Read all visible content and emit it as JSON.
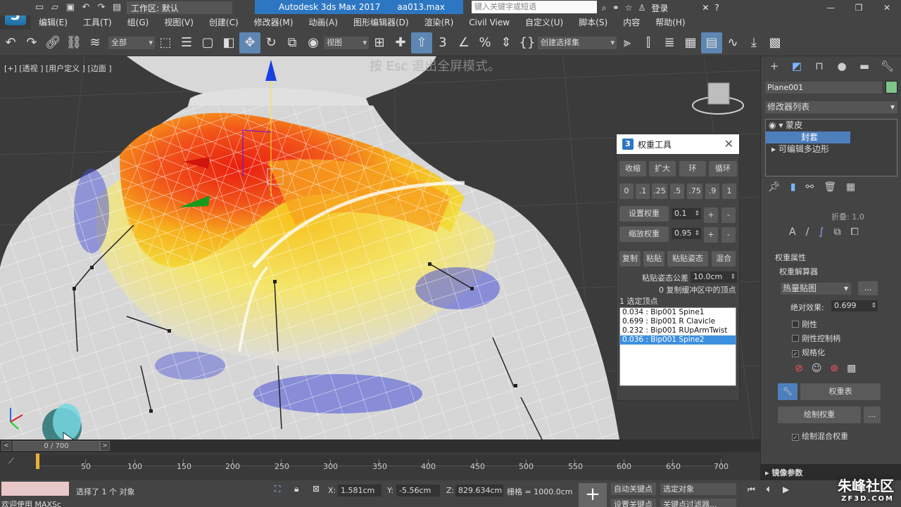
{
  "app": {
    "logo_text": "3",
    "workspace": "工作区: 默认",
    "window_title": "Autodesk 3ds Max 2017",
    "file_name": "aa013.max",
    "search_placeholder": "键入关键字或短语",
    "login_label": "登录"
  },
  "menu": [
    "编辑(E)",
    "工具(T)",
    "组(G)",
    "视图(V)",
    "创建(C)",
    "修改器(M)",
    "动画(A)",
    "图形编辑器(D)",
    "渲染(R)",
    "Civil View",
    "自定义(U)",
    "脚本(S)",
    "内容",
    "帮助(H)"
  ],
  "toolbar": {
    "select_filter": "全部",
    "ref_coord": "视图",
    "named_selection": "创建选择集"
  },
  "viewport": {
    "label": "[+] [透视 ] [用户定义 ] [边面 ]",
    "hint": "按 Esc 退出全屏模式。"
  },
  "weight_tool": {
    "title": "权重工具",
    "shrink": "收缩",
    "grow": "扩大",
    "ring": "环",
    "loop": "循环",
    "presets": [
      "0",
      ".1",
      ".25",
      ".5",
      ".75",
      ".9",
      "1"
    ],
    "set_weight": "设置权重",
    "set_weight_value": "0.1",
    "scale_weight": "缩放权重",
    "scale_weight_value": "0.95",
    "plus": "+",
    "minus": "-",
    "copy": "复制",
    "paste": "粘贴",
    "paste_pos": "粘贴姿态",
    "blend": "混合",
    "paste_tolerance_label": "粘贴姿态公差",
    "paste_tolerance_value": "10.0cm",
    "buffer_text": "0 复制缓冲区中的顶点",
    "selected_text": "1 选定顶点",
    "influences": [
      "0.034 : Bip001 Spine1",
      "0.699 : Bip001 R Clavicle",
      "0.232 : Bip001 RUpArmTwist",
      "0.036 : Bip001 Spine2"
    ],
    "selected_index": 3
  },
  "command_panel": {
    "object_name": "Plane001",
    "object_color": "#7fc58a",
    "modifier_list": "修改器列表",
    "stack": {
      "skin": "蒙皮",
      "envelope": "封套",
      "editable_poly": "可编辑多边形"
    },
    "falloff_label": "折叠: 1.0",
    "weight_props": "权重属性",
    "weight_solver": "权重解算器",
    "heat_map": "热量贴图",
    "more": "...",
    "abs_effect_label": "绝对效果:",
    "abs_effect_value": "0.699",
    "rigid": "刚性",
    "rigid_handles": "刚性控制柄",
    "normalize": "规格化",
    "weight_table": "权重表",
    "paint_weights": "绘制权重",
    "paint_blend": "绘制混合权重",
    "mirror_params": "镜像参数"
  },
  "timeline": {
    "frame": "0 / 700",
    "ticks": [
      "50",
      "100",
      "150",
      "200",
      "250",
      "300",
      "350",
      "400",
      "450",
      "500",
      "550",
      "600",
      "650",
      "700"
    ]
  },
  "status": {
    "selected": "选择了 1 个 对象",
    "welcome": "欢迎使用 MAXSc",
    "x_label": "X:",
    "x_value": "1.581cm",
    "y_label": "Y:",
    "y_value": "-5.56cm",
    "z_label": "Z:",
    "z_value": "829.634cm",
    "grid": "栅格 = 1000.0cm",
    "auto_key": "自动关键点",
    "selected_obj": "选定对象",
    "set_key": "设置关键点",
    "key_filter": "关键点过滤器..."
  },
  "watermark": {
    "text": "朱峰社区",
    "sub": "ZF3D.COM"
  }
}
